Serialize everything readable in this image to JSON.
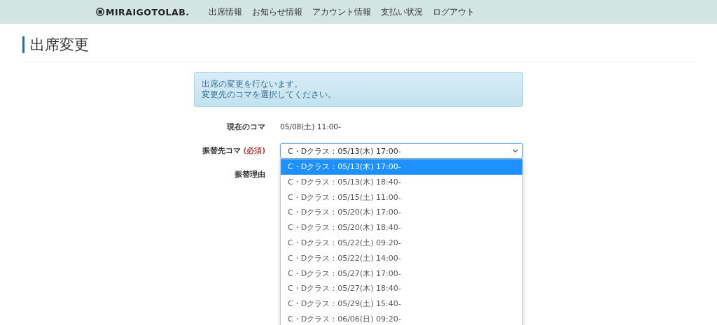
{
  "header": {
    "logo": "MIRAIGOTOLAB.",
    "nav": [
      "出席情報",
      "お知らせ情報",
      "アカウント情報",
      "支払い状況",
      "ログアウト"
    ]
  },
  "page_title": "出席変更",
  "alert": {
    "lines": [
      "出席の変更を行ないます。",
      "変更先のコマを選択してください。"
    ]
  },
  "form": {
    "rows": [
      {
        "kind": "text",
        "label": "現在のコマ",
        "value": "05/08(土) 11:00-"
      },
      {
        "kind": "select",
        "label": "振替先コマ",
        "required": "(必須)",
        "value": "C・Dクラス：05/13(木) 17:00-",
        "expanded": true,
        "options": [
          {
            "label": "C・Dクラス：05/13(木) 17:00-",
            "selected": true
          },
          {
            "label": "C・Dクラス：05/13(木) 18:40-",
            "selected": false
          },
          {
            "label": "C・Dクラス：05/15(土) 11:00-",
            "selected": false
          },
          {
            "label": "C・Dクラス：05/20(木) 17:00-",
            "selected": false
          },
          {
            "label": "C・Dクラス：05/20(木) 18:40-",
            "selected": false
          },
          {
            "label": "C・Dクラス：05/22(土) 09:20-",
            "selected": false
          },
          {
            "label": "C・Dクラス：05/22(土) 14:00-",
            "selected": false
          },
          {
            "label": "C・Dクラス：05/27(木) 17:00-",
            "selected": false
          },
          {
            "label": "C・Dクラス：05/27(木) 18:40-",
            "selected": false
          },
          {
            "label": "C・Dクラス：05/29(土) 15:40-",
            "selected": false
          },
          {
            "label": "C・Dクラス：06/06(日) 09:20-",
            "selected": false
          }
        ]
      },
      {
        "kind": "label",
        "label": "振替理由"
      }
    ]
  }
}
